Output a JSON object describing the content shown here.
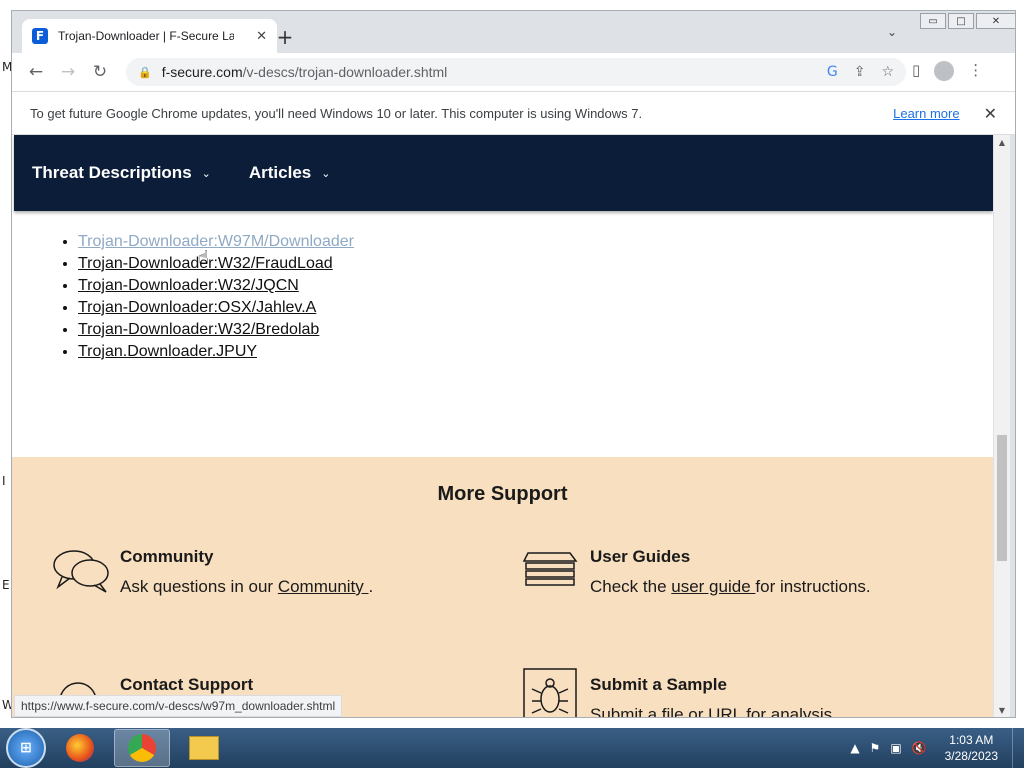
{
  "desktop": {
    "letters": [
      "M",
      "I",
      "E",
      "W"
    ]
  },
  "browser": {
    "tab_title": "Trojan-Downloader | F-Secure La",
    "tab_favicon": "F",
    "new_tab_symbol": "+",
    "url_domain": "f-secure.com",
    "url_path": "/v-descs/trojan-downloader.shtml",
    "window_controls": {
      "minimize": "▭",
      "maximize": "□",
      "close": "✕"
    }
  },
  "infobar": {
    "message": "To get future Google Chrome updates, you'll need Windows 10 or later. This computer is using Windows 7.",
    "link": "Learn more",
    "close": "✕"
  },
  "sitenav": {
    "items": [
      {
        "label": "Threat Descriptions"
      },
      {
        "label": "Articles"
      }
    ]
  },
  "links": [
    "Trojan-Downloader:W97M/Downloader",
    "Trojan-Downloader:W32/FraudLoad",
    "Trojan-Downloader:W32/JQCN",
    "Trojan-Downloader:OSX/Jahlev.A",
    "Trojan-Downloader:W32/Bredolab",
    "Trojan.Downloader.JPUY"
  ],
  "support": {
    "title": "More Support",
    "community": {
      "title": "Community",
      "desc_prefix": "Ask questions in our ",
      "desc_link": "Community ",
      "desc_suffix": "."
    },
    "guides": {
      "title": "User Guides",
      "desc_prefix": "Check the ",
      "desc_link": "user guide ",
      "desc_suffix": "for instructions."
    },
    "contact": {
      "title": "Contact Support"
    },
    "sample": {
      "title": "Submit a Sample",
      "desc": "Submit a file or URL for analysis."
    }
  },
  "status_url": "https://www.f-secure.com/v-descs/w97m_downloader.shtml",
  "taskbar": {
    "time": "1:03 AM",
    "date": "3/28/2023"
  }
}
